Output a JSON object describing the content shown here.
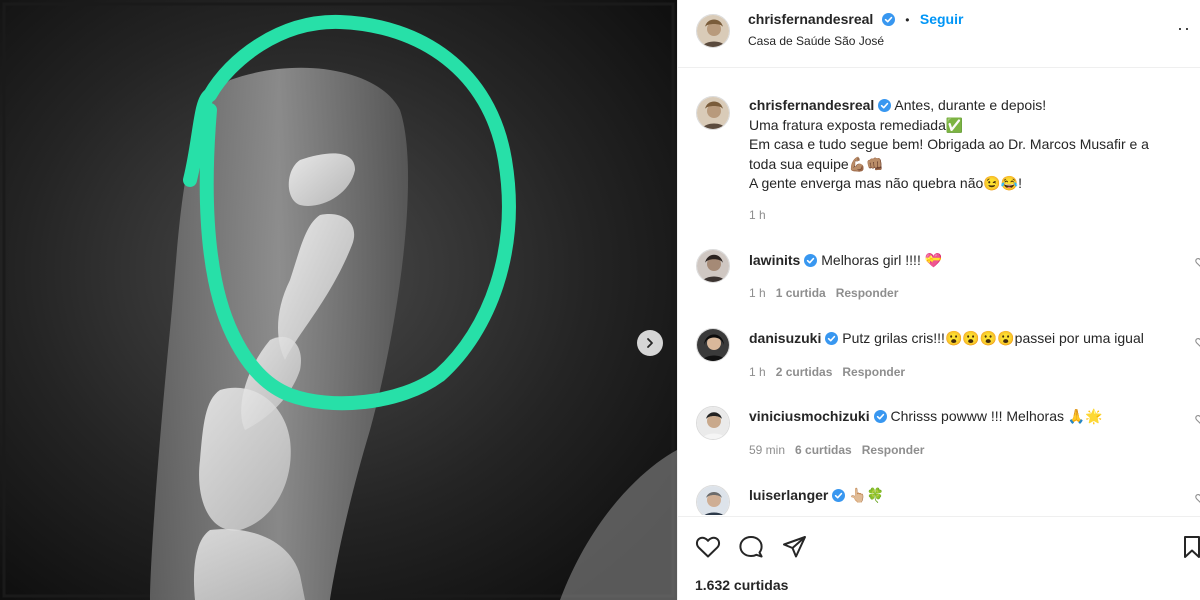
{
  "post": {
    "username": "chrisfernandesreal",
    "follow_label": "Seguir",
    "location": "Casa de Saúde São José",
    "more_label": "··",
    "caption": {
      "lines": [
        "Antes, durante e depois!",
        "Uma fratura exposta remediada✅",
        "Em casa e tudo segue bem! Obrigada ao Dr. Marcos Musafir e a",
        "toda sua equipe💪🏽👊🏽",
        "A gente enverga mas não quebra não😉😂!"
      ],
      "time": "1 h"
    },
    "likes_label": "1.632 curtidas"
  },
  "comments": [
    {
      "username": "lawinits",
      "text": "Melhoras girl !!!! 💝",
      "time": "1 h",
      "likes": "1 curtida",
      "reply": "Responder"
    },
    {
      "username": "danisuzuki",
      "text": "Putz grilas cris!!!😮😮😮😮passei por uma igual",
      "time": "1 h",
      "likes": "2 curtidas",
      "reply": "Responder"
    },
    {
      "username": "viniciusmochizuki",
      "text": "Chrisss powww !!! Melhoras 🙏🌟",
      "time": "59 min",
      "likes": "6 curtidas",
      "reply": "Responder"
    },
    {
      "username": "luiserlanger",
      "text": "👆🏼🍀"
    }
  ],
  "icons": {
    "like": "heart-icon",
    "comment": "comment-bubble-icon",
    "share": "paper-plane-icon",
    "save": "bookmark-icon",
    "next": "chevron-right-icon",
    "verified": "verified-badge-icon"
  },
  "colors": {
    "link_blue": "#0095f6",
    "verified_blue": "#3897f0",
    "highlight_circle": "#27e0a8",
    "secondary_text": "#8e8e8e"
  }
}
